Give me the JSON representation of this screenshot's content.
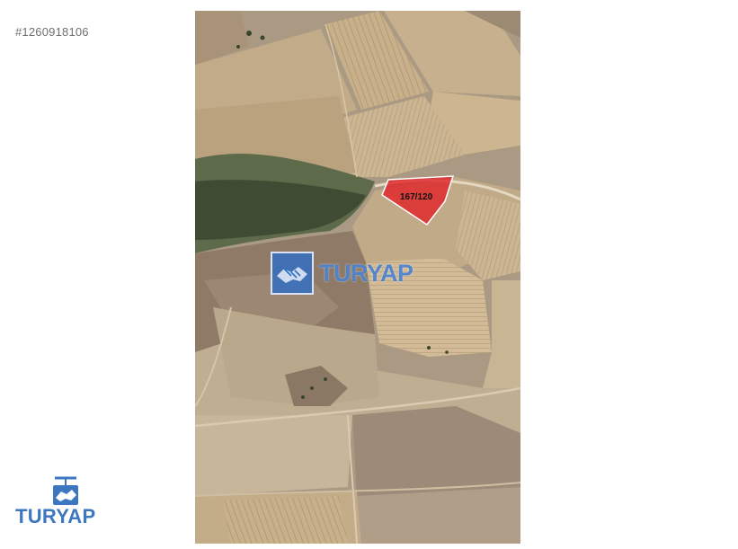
{
  "listing": {
    "id": "#1260918106"
  },
  "map": {
    "parcel_label": "167/120",
    "parcel_color": "#e0252b",
    "watermark_text": "TURYAP",
    "watermark_color": "#3c78cd"
  },
  "brand": {
    "name": "TURYAP",
    "color": "#3d77bf"
  }
}
